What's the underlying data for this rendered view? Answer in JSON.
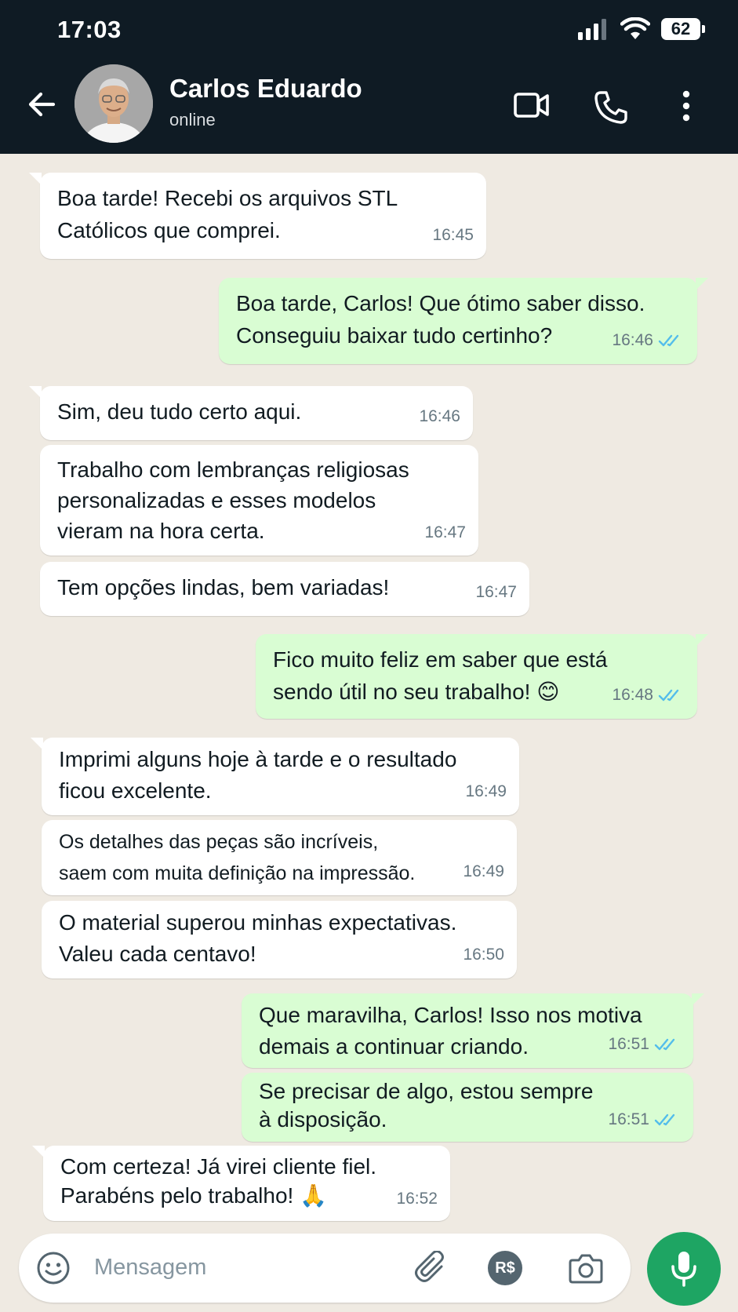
{
  "status_bar": {
    "time": "17:03",
    "battery": "62"
  },
  "header": {
    "contact_name": "Carlos Eduardo",
    "contact_status": "online"
  },
  "messages": [
    {
      "dir": "in",
      "text": "Boa tarde! Recebi os arquivos STL\nCatólicos que comprei.",
      "time": "16:45"
    },
    {
      "dir": "out",
      "text": "Boa tarde, Carlos! Que ótimo saber disso.\nConseguiu baixar tudo certinho?",
      "time": "16:46",
      "read": true
    },
    {
      "dir": "in",
      "text": "Sim, deu tudo certo aqui.",
      "time": "16:46"
    },
    {
      "dir": "in",
      "text": "Trabalho com lembranças religiosas\npersonalizadas e esses modelos\nvieram na hora certa.",
      "time": "16:47"
    },
    {
      "dir": "in",
      "text": "Tem opções lindas, bem variadas!",
      "time": "16:47"
    },
    {
      "dir": "out",
      "text": "Fico muito feliz em saber que está\nsendo útil no seu trabalho! 😊",
      "time": "16:48",
      "read": true
    },
    {
      "dir": "in",
      "text": "Imprimi alguns hoje à tarde e o resultado\nficou excelente.",
      "time": "16:49"
    },
    {
      "dir": "in",
      "text": "Os detalhes das peças são incríveis,\nsaem com muita definição na impressão.",
      "time": "16:49"
    },
    {
      "dir": "in",
      "text": "O material superou minhas expectativas.\nValeu cada centavo!",
      "time": "16:50"
    },
    {
      "dir": "out",
      "text": "Que maravilha, Carlos! Isso nos motiva\ndemais a continuar criando.",
      "time": "16:51",
      "read": true
    },
    {
      "dir": "out",
      "text": "Se precisar de algo, estou sempre\nà disposição.",
      "time": "16:51",
      "read": true
    },
    {
      "dir": "in",
      "text": "Com certeza! Já virei cliente fiel.\nParabéns pelo trabalho! 🙏",
      "time": "16:52"
    }
  ],
  "composer": {
    "placeholder": "Mensagem",
    "payment_label": "R$"
  },
  "colors": {
    "header_bg": "#0f1b24",
    "incoming_bubble": "#ffffff",
    "outgoing_bubble": "#d9fdd3",
    "read_ticks": "#53bdeb",
    "mic_button": "#1ea563"
  }
}
